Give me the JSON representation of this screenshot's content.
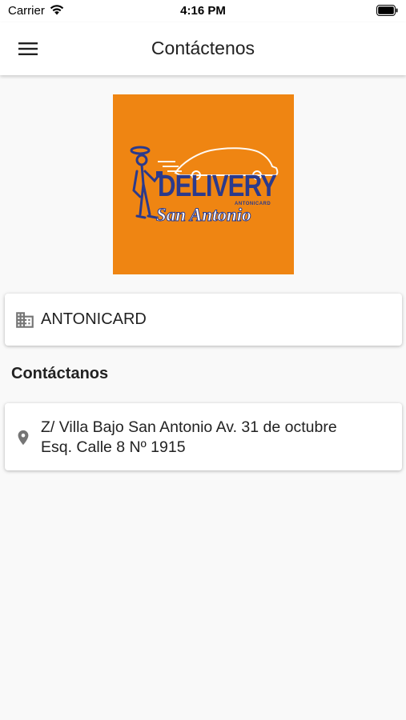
{
  "status_bar": {
    "carrier": "Carrier",
    "time": "4:16 PM"
  },
  "app_bar": {
    "title": "Contáctenos",
    "menu_icon": "hamburger-menu-icon"
  },
  "logo": {
    "brand": "DELIVERY",
    "sub_brand": "ANTONICARD",
    "tagline": "San Antonio",
    "background_color": "#ef8512",
    "text_color": "#2b3a8c"
  },
  "company": {
    "icon": "business-building-icon",
    "name": "ANTONICARD"
  },
  "contact_section": {
    "title": "Contáctanos"
  },
  "address": {
    "icon": "location-pin-icon",
    "line1": "Z/ Villa Bajo San Antonio Av. 31 de octubre",
    "line2": "Esq. Calle 8 Nº 1915"
  }
}
